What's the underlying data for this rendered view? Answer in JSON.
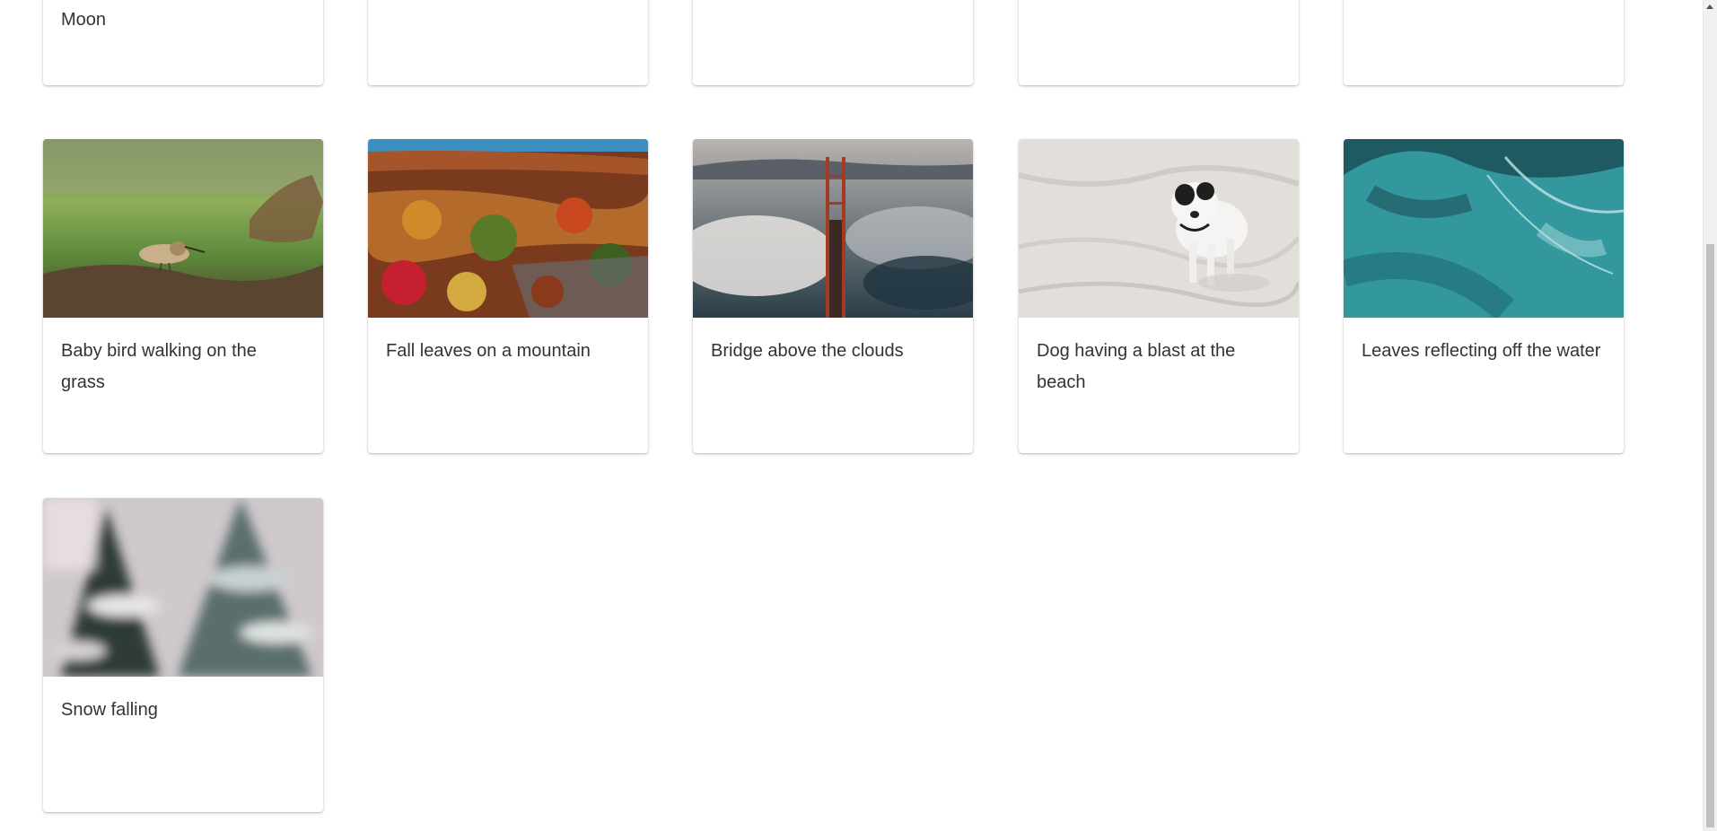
{
  "top_row": [
    {
      "title": "Moon",
      "visible_text": "Moon"
    },
    {
      "title": ""
    },
    {
      "title": ""
    },
    {
      "title": ""
    },
    {
      "title": ""
    }
  ],
  "videos": [
    {
      "title": "Baby bird walking on the grass",
      "thumbnail": "bird-on-grass"
    },
    {
      "title": "Fall leaves on a mountain",
      "thumbnail": "autumn-mountain"
    },
    {
      "title": "Bridge above the clouds",
      "thumbnail": "bridge-fog"
    },
    {
      "title": "Dog having a blast at the beach",
      "thumbnail": "dog-on-sand"
    },
    {
      "title": "Leaves reflecting off the water",
      "thumbnail": "palm-water"
    },
    {
      "title": "Snow falling",
      "thumbnail": "snow-trees"
    }
  ],
  "colors": {
    "card_bg": "#ffffff",
    "text": "#333333",
    "scrollbar_track": "#f1f1f1",
    "scrollbar_thumb": "#c1c1c1"
  }
}
